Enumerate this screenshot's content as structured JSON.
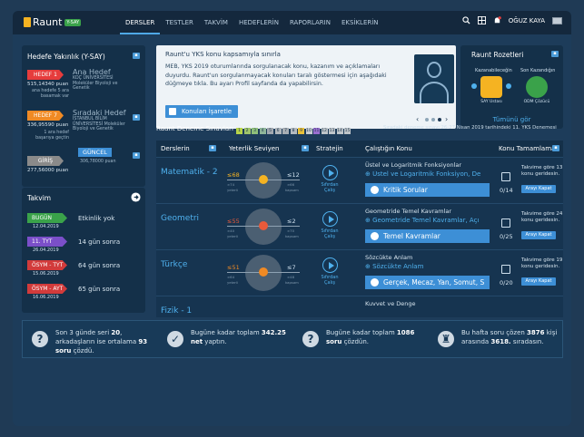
{
  "header": {
    "logo_text": "Raunt",
    "logo_badge": "Y-SAY",
    "nav": [
      "DERSLER",
      "TESTLER",
      "TAKVİM",
      "HEDEFLERİN",
      "RAPORLARIN",
      "EKSİKLERİN"
    ],
    "user": "OĞUZ KAYA"
  },
  "goals_panel": {
    "title": "Hedefe Yakınlık (Y-SAY)",
    "rows": [
      {
        "tag": "HEDEF 1",
        "color": "#e63c3c",
        "score": "515,14340 puan",
        "title": "Ana Hedef",
        "sub": "KOÇ ÜNİVERSİTESİ Moleküler Biyoloji ve Genetik",
        "note": "ana hedefe 5 ara basamak var"
      },
      {
        "tag": "HEDEF 7",
        "color": "#f08a24",
        "score": "336,95590 puan",
        "title": "Sıradaki Hedef",
        "sub": "İSTANBUL BİLİM ÜNİVERSİTESİ Moleküler Biyoloji ve Genetik",
        "note": "1 ara hedef başarıya geçtin"
      },
      {
        "tag": "GİRİŞ",
        "color": "#8a8a8a",
        "score": "277,56000 puan",
        "title": "GÜNCEL",
        "sub": "306,78000 puan",
        "note": ""
      }
    ]
  },
  "calendar_panel": {
    "title": "Takvim",
    "items": [
      {
        "tag": "BUGÜN",
        "color": "#3aa24a",
        "date": "12.04.2019",
        "text": "Etkinlik yok"
      },
      {
        "tag": "11. TYT",
        "color": "#7b4fc9",
        "date": "26.04.2019",
        "text": "14 gün sonra"
      },
      {
        "tag": "ÖSYM - TYT",
        "color": "#d23b3b",
        "date": "15.06.2019",
        "text": "64 gün sonra"
      },
      {
        "tag": "ÖSYM - AYT",
        "color": "#d23b3b",
        "date": "16.06.2019",
        "text": "65 gün sonra"
      }
    ]
  },
  "banner": {
    "title": "Raunt'u YKS konu kapsamıyla sınırla",
    "desc": "MEB, YKS 2019 oturumlarında sorgulanacak konu, kazanım ve açıklamaları duyurdu. Raunt'un sorgulanmayacak konuları taralı göstermesi için aşağıdaki düğmeye tıkla. Bu ayarı Profil sayfanda da yapabilirsin.",
    "button": "Konuları İşaretle"
  },
  "rozet": {
    "title": "Raunt Rozetleri",
    "left_label": "Kazanabileceğin",
    "right_label": "Son Kazandığın",
    "badge1": "SAY Ustası",
    "badge2": "ODM Çözücü",
    "link": "Tümünü gör"
  },
  "deneme": {
    "title": "Raunt Deneme Sınavları",
    "numbers": [
      "1",
      "2",
      "3",
      "4",
      "5",
      "6",
      "7",
      "8",
      "9",
      "10",
      "11",
      "12",
      "13",
      "14",
      "15"
    ],
    "info": "Sıradaki deneme sınavı 26-27 Nisan 2019 tarihindeki 11. YKS Denemesi"
  },
  "table": {
    "headers": [
      "Derslerin",
      "Yeterlik Seviyen",
      "Stratejin",
      "Çalıştığın Konu",
      "Konu Tamamlama"
    ],
    "rows": [
      {
        "lesson": "Matematik - 2",
        "left_val": "≤68",
        "right_val": "≤12",
        "left_sub": "≈74",
        "right_sub": "≈66",
        "left_label": "yeterli",
        "right_label": "kapsam",
        "dot_color": "#f5b322",
        "strategy": "Sıfırdan Çalış",
        "topic": "Üstel ve Logaritmik Fonksiyonlar",
        "subtopic": "Üstel ve Logaritmik Fonksiyon, De",
        "button": "Kritik Sorular",
        "count": "0/14",
        "comp_text": "Takvime göre 13 konu geridesin.",
        "comp_btn": "Arayı Kapat"
      },
      {
        "lesson": "Geometri",
        "left_val": "≤55",
        "right_val": "≤2",
        "left_sub": "≈40",
        "right_sub": "≈70",
        "left_label": "yeterli",
        "right_label": "kapsam",
        "dot_color": "#e85a3a",
        "strategy": "Sıfırdan Çalış",
        "topic": "Geometride Temel Kavramlar",
        "subtopic": "Geometride Temel Kavramlar, Açı",
        "button": "Temel Kavramlar",
        "count": "0/25",
        "comp_text": "Takvime göre 24 konu geridesin.",
        "comp_btn": "Arayı Kapat"
      },
      {
        "lesson": "Türkçe",
        "left_val": "≤51",
        "right_val": "≤7",
        "left_sub": "≈64",
        "right_sub": "≈48",
        "left_label": "yeterli",
        "right_label": "kapsam",
        "dot_color": "#f08a24",
        "strategy": "Sıfırdan Çalış",
        "topic": "Sözcükte Anlam",
        "subtopic": "Sözcükte Anlam",
        "button": "Gerçek, Mecaz, Yan, Somut, S",
        "count": "0/20",
        "comp_text": "Takvime göre 19 konu geridesin.",
        "comp_btn": "Arayı Kapat"
      },
      {
        "lesson": "Fizik - 1",
        "topic": "Kuvvet ve Denge"
      }
    ]
  },
  "bottom": [
    {
      "icon": "?",
      "pre": "Son 3 günde seri ",
      "b1": "20",
      "mid": ", arkadaşların ise ortalama ",
      "b2": "93 soru",
      "post": " çözdü."
    },
    {
      "icon": "✓",
      "pre": "Bugüne kadar toplam ",
      "b1": "342.25 net",
      "mid": " yaptın.",
      "b2": "",
      "post": ""
    },
    {
      "icon": "?",
      "pre": "Bugüne kadar toplam ",
      "b1": "1086 soru",
      "mid": " çözdün.",
      "b2": "",
      "post": ""
    },
    {
      "icon": "♜",
      "pre": "Bu hafta soru çözen ",
      "b1": "3876",
      "mid": " kişi arasında ",
      "b2": "3618.",
      "post": " sıradasın."
    }
  ],
  "colors": {
    "accent": "#3d8fd6",
    "link": "#4fb1ee",
    "bg": "#1d3c5a"
  }
}
